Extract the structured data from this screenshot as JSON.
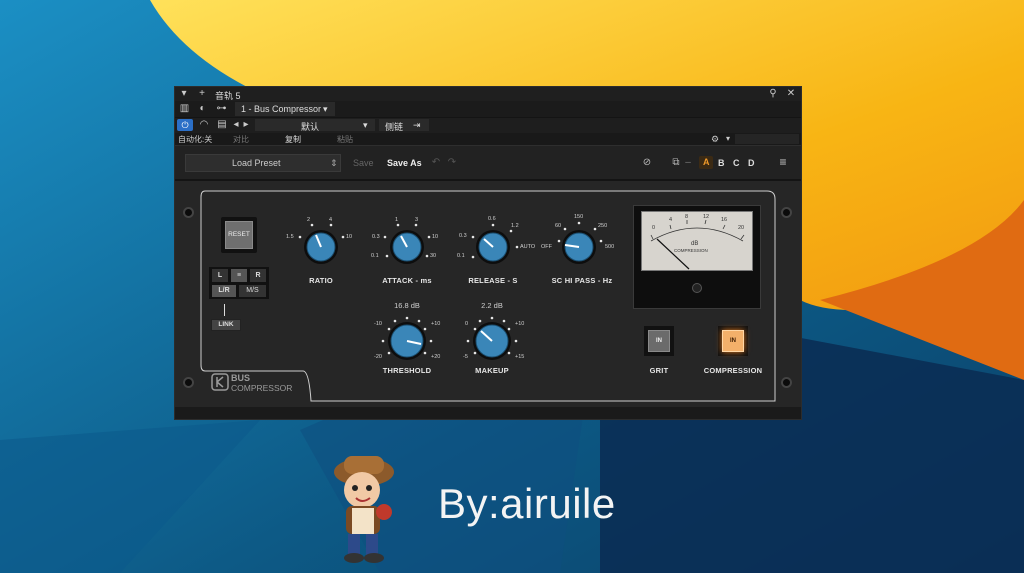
{
  "window": {
    "track_name": "音轨 5",
    "plugin_slot": "1 - Bus Compressor",
    "preset_default": "默认",
    "sidechain_label": "侧链",
    "auto_label": "自动化:关",
    "compare_label": "对比",
    "copy_label": "复制",
    "paste_label": "粘贴"
  },
  "preset_bar": {
    "load_preset": "Load Preset",
    "save": "Save",
    "save_as": "Save As",
    "slots": [
      "A",
      "B",
      "C",
      "D"
    ],
    "active_slot": "A"
  },
  "plugin": {
    "reset": "RESET",
    "channels": [
      "L",
      "≡",
      "R"
    ],
    "modes": [
      "L/R",
      "M/S"
    ],
    "link": "LINK",
    "brand_top": "BUS",
    "brand_bottom": "COMPRESSOR",
    "ratio": {
      "label": "RATIO",
      "ticks": [
        "1.5",
        "2",
        "4",
        "10"
      ]
    },
    "attack": {
      "label": "ATTACK - ms",
      "ticks": [
        "0.1",
        "0.3",
        "1",
        "3",
        "10",
        "30"
      ]
    },
    "release": {
      "label": "RELEASE - S",
      "ticks": [
        "0.1",
        "0.3",
        "0.6",
        "1.2",
        "AUTO"
      ]
    },
    "schp": {
      "label": "SC HI PASS - Hz",
      "ticks": [
        "OFF",
        "60",
        "150",
        "250",
        "500"
      ]
    },
    "threshold": {
      "label": "THRESHOLD",
      "value": "16.8 dB",
      "ticks": [
        "-10",
        "-20",
        "+10",
        "+20"
      ]
    },
    "makeup": {
      "label": "MAKEUP",
      "value": "2.2 dB",
      "ticks": [
        "0",
        "-5",
        "+10",
        "+15"
      ]
    },
    "meter": {
      "unit": "dB",
      "caption": "COMPRESSION",
      "scale": [
        "0",
        "4",
        "8",
        "12",
        "16",
        "20"
      ]
    },
    "grit": {
      "label": "GRIT",
      "button": "IN"
    },
    "compression": {
      "label": "COMPRESSION",
      "button": "IN"
    }
  },
  "credit": "By:airuile",
  "colors": {
    "knob_blue": "#3a86b8",
    "accent_orange": "#e07a1f",
    "wall_blue": "#0d5a86",
    "wall_yellow": "#f6b614"
  }
}
